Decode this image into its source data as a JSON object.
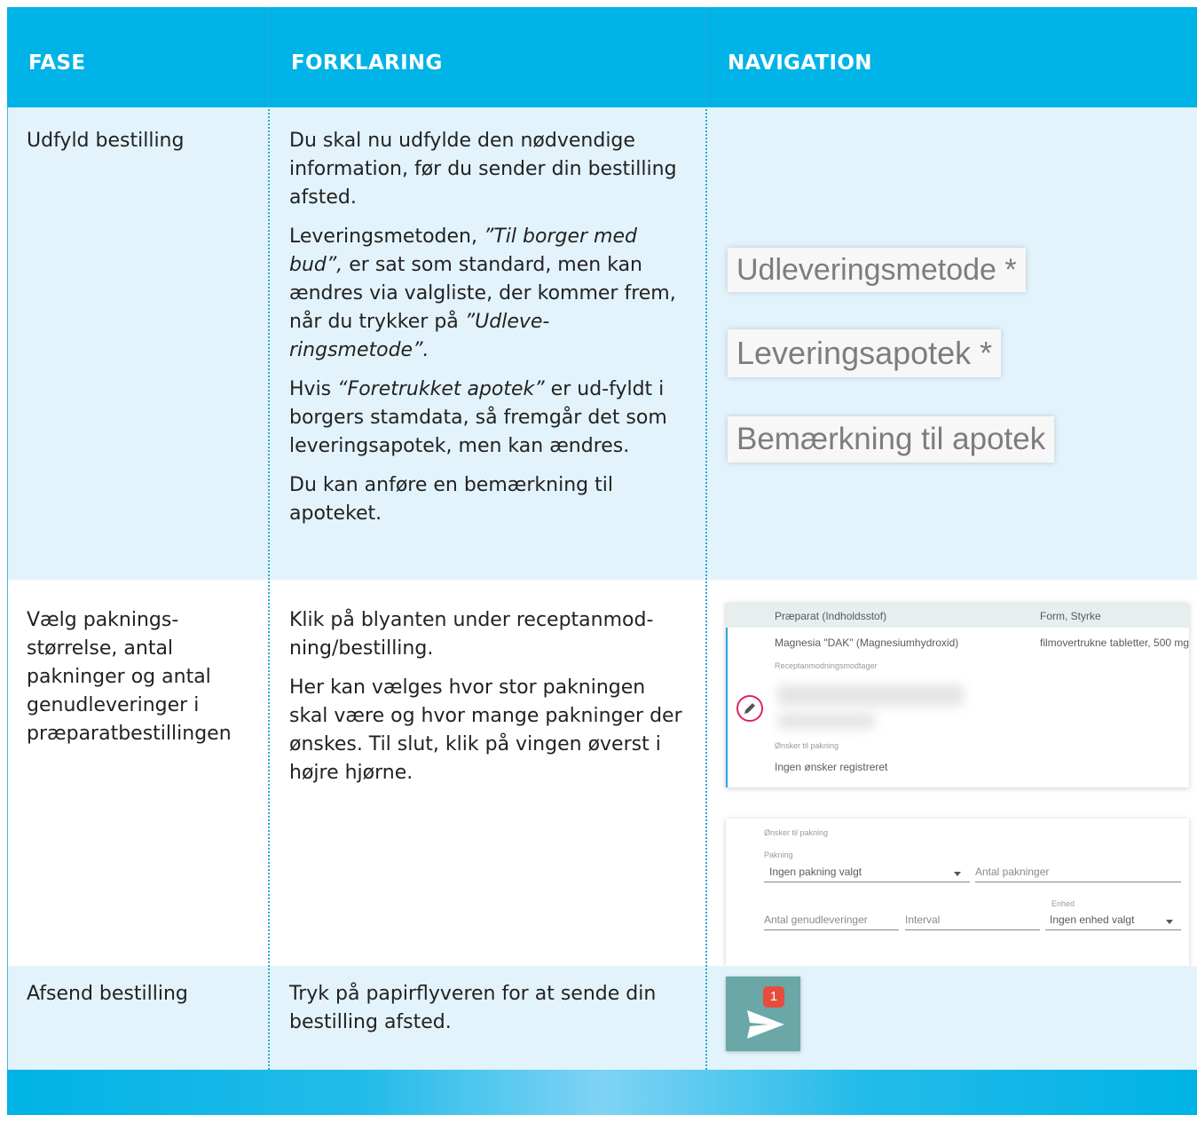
{
  "header": {
    "col1": "FASE",
    "col2": "FORKLARING",
    "col3": "NAVIGATION"
  },
  "rows": [
    {
      "fase": "Udfyld bestilling",
      "p1": "Du skal nu udfylde den nødvendige information, før du sender din bestilling afsted.",
      "p2_pre": "Leveringsmetoden, ",
      "p2_em1": "”Til borger med bud”,",
      "p2_mid": " er sat som standard, men kan ændres via valgliste, der kommer frem, når du trykker på ",
      "p2_em2": "”Udleve-ringsmetode”.",
      "p3_pre": "Hvis ",
      "p3_em": "“Foretrukket apotek”",
      "p3_post": " er ud-fyldt i borgers stamdata, så fremgår det som leveringsapotek, men kan ændres.",
      "p4": "Du kan anføre en bemærkning til apoteket.",
      "nav": {
        "field1": "Udleveringsmetode *",
        "field2": "Leveringsapotek *",
        "field3": "Bemærkning til apotek"
      }
    },
    {
      "fase": "Vælg paknings-størrelse, antal pakninger og antal genudleveringer i præparatbestillingen",
      "p1": "Klik på blyanten under receptanmod-ning/bestilling.",
      "p2": "Her kan vælges hvor stor pakningen skal være og hvor mange pakninger der ønskes. Til slut, klik på vingen øverst i højre hjørne.",
      "card1": {
        "col_a": "Præparat (Indholdsstof)",
        "col_b": "Form, Styrke",
        "drug": "Magnesia \"DAK\" (Magnesiumhydroxid)",
        "form": "filmovertrukne tabletter, 500 mg",
        "recipient_label": "Receptanmodningsmodtager",
        "wish_label": "Ønsker til pakning",
        "wish_value": "Ingen ønsker registreret",
        "icon": "pencil-icon"
      },
      "card2": {
        "title": "Ønsker til pakning",
        "pakning_label": "Pakning",
        "pakning_value": "Ingen pakning valgt",
        "antal_pakninger": "Antal pakninger",
        "antal_genudleveringer": "Antal genudleveringer",
        "interval": "Interval",
        "enhed_label": "Enhed",
        "enhed_value": "Ingen enhed valgt"
      }
    },
    {
      "fase": "Afsend bestilling",
      "p1": "Tryk på papirflyveren for at sende din bestilling afsted.",
      "badge": "1",
      "icon": "paper-plane-icon"
    }
  ],
  "colors": {
    "header_bg": "#00b3e6",
    "row_light": "#e3f3fb",
    "separator": "#2aa9d8",
    "send_button": "#6aa7a6",
    "badge": "#e74c3c",
    "pencil_ring": "#e0245e"
  }
}
